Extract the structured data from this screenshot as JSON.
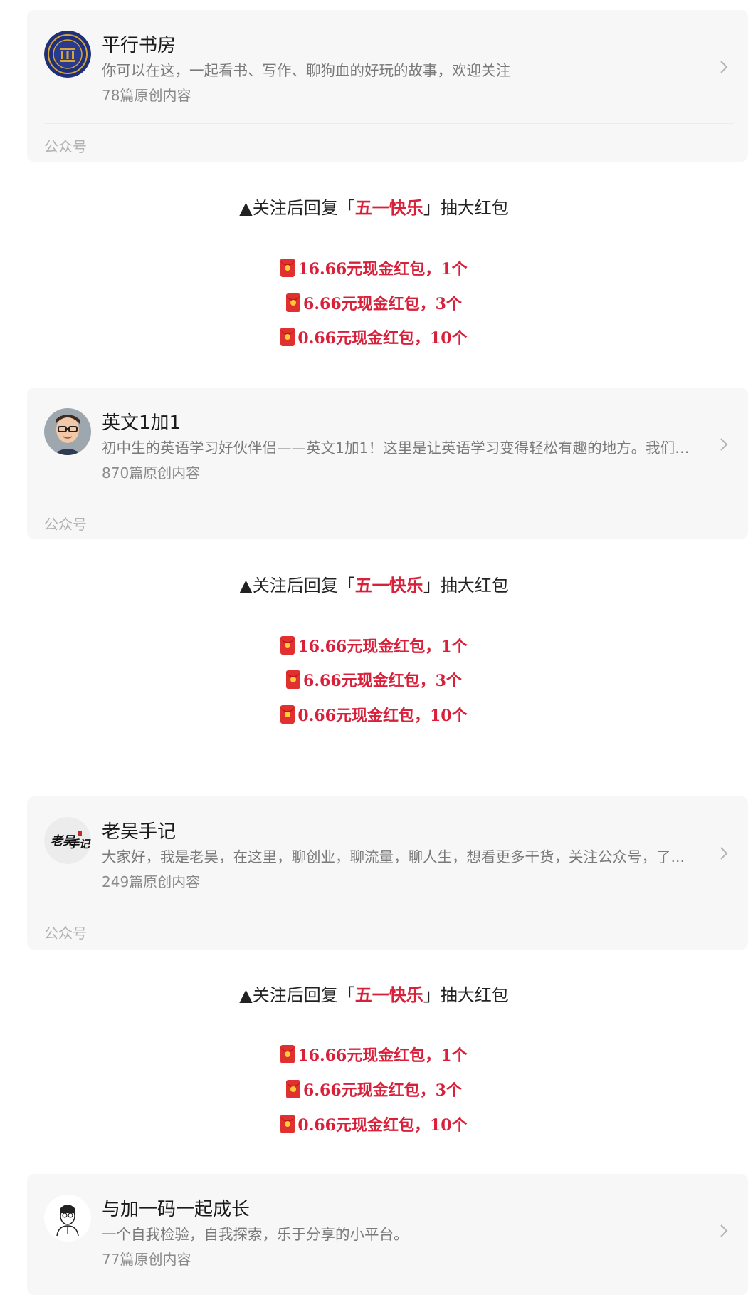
{
  "cards": [
    {
      "name": "平行书房",
      "desc": "你可以在这，一起看书、写作、聊狗血的好玩的故事，欢迎关注",
      "count": "78篇原创内容",
      "type": "公众号",
      "avatar_icon": "library-logo-icon"
    },
    {
      "name": "英文1加1",
      "desc": "初中生的英语学习好伙伴侣——英文1加1！这里是让英语学习变得轻松有趣的地方。我们不...",
      "count": "870篇原创内容",
      "type": "公众号",
      "avatar_icon": "cartoon-person-glasses-icon"
    },
    {
      "name": "老吴手记",
      "desc": "大家好，我是老吴，在这里，聊创业，聊流量，聊人生，想看更多干货，关注公众号，了...",
      "count": "249篇原创内容",
      "type": "公众号",
      "avatar_icon": "calligraphy-logo-icon"
    },
    {
      "name": "与加一码一起成长",
      "desc": "一个自我检验，自我探索，乐于分享的小平台。",
      "count": "77篇原创内容",
      "type": "公众号",
      "avatar_icon": "sketch-person-icon"
    }
  ],
  "promo": {
    "prefix": "▲关注后回复「",
    "keyword": "五一快乐",
    "suffix": "」抽大红包",
    "prizes": [
      "16.66元现金红包，1个",
      "6.66元现金红包，3个",
      "0.66元现金红包，10个"
    ],
    "prize_icon": "red-envelope-icon"
  },
  "colors": {
    "accent_red": "#d9203a",
    "card_bg": "#f7f7f7"
  }
}
